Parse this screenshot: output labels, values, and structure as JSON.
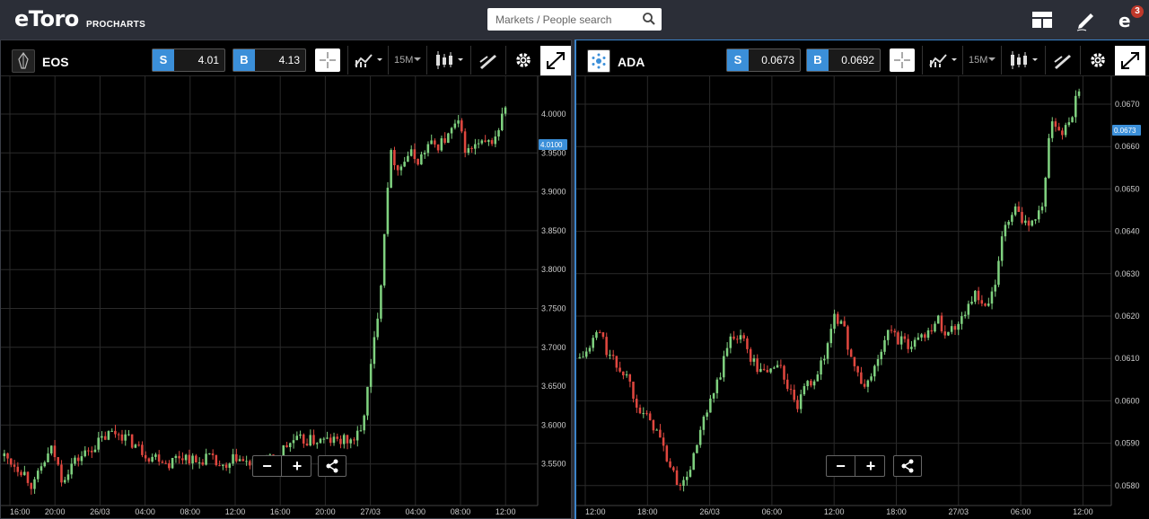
{
  "header": {
    "logo_text": "eToro",
    "logo_sub": "PROCHARTS",
    "search_placeholder": "Markets / People search",
    "notification_count": "3"
  },
  "panels": [
    {
      "asset": "EOS",
      "sell_label": "S",
      "sell_price": "4.01",
      "buy_label": "B",
      "buy_price": "4.13",
      "timeframe": "15M",
      "current_price_tag": "4.0100",
      "y_ticks": [
        "4.0000",
        "3.9500",
        "3.9000",
        "3.8500",
        "3.8000",
        "3.7500",
        "3.7000",
        "3.6500",
        "3.6000",
        "3.5500"
      ],
      "x_ticks": [
        "16:00",
        "20:00",
        "26/03",
        "04:00",
        "08:00",
        "12:00",
        "16:00",
        "20:00",
        "27/03",
        "04:00",
        "08:00",
        "12:00"
      ],
      "zoom_out": "−",
      "zoom_in": "+"
    },
    {
      "asset": "ADA",
      "sell_label": "S",
      "sell_price": "0.0673",
      "buy_label": "B",
      "buy_price": "0.0692",
      "timeframe": "15M",
      "current_price_tag": "0.0673",
      "y_ticks": [
        "0.0670",
        "0.0660",
        "0.0650",
        "0.0640",
        "0.0630",
        "0.0620",
        "0.0610",
        "0.0600",
        "0.0590",
        "0.0580"
      ],
      "x_ticks": [
        "12:00",
        "18:00",
        "26/03",
        "06:00",
        "12:00",
        "18:00",
        "27/03",
        "06:00",
        "12:00"
      ],
      "zoom_out": "−",
      "zoom_in": "+"
    }
  ],
  "colors": {
    "up": "#7fd17f",
    "down": "#e0473f",
    "accent": "#3b8fd9",
    "grid": "#2a2a2a"
  },
  "chart_data": [
    {
      "type": "candlestick",
      "title": "EOS",
      "ylim": [
        3.51,
        4.04
      ],
      "close_path": [
        3.56,
        3.55,
        3.54,
        3.52,
        3.55,
        3.57,
        3.53,
        3.55,
        3.56,
        3.57,
        3.58,
        3.59,
        3.59,
        3.58,
        3.57,
        3.56,
        3.56,
        3.55,
        3.56,
        3.56,
        3.55,
        3.56,
        3.55,
        3.54,
        3.56,
        3.55,
        3.55,
        3.56,
        3.55,
        3.57,
        3.58,
        3.58,
        3.58,
        3.58,
        3.58,
        3.58,
        3.58,
        3.59,
        3.67,
        3.77,
        3.95,
        3.93,
        3.95,
        3.94,
        3.96,
        3.96,
        3.97,
        3.99,
        3.95,
        3.96,
        3.96,
        3.97,
        4.01
      ]
    },
    {
      "type": "candlestick",
      "title": "ADA",
      "ylim": [
        0.0578,
        0.0674
      ],
      "close_path": [
        0.061,
        0.0612,
        0.0617,
        0.0611,
        0.0608,
        0.0606,
        0.06,
        0.0596,
        0.0594,
        0.0588,
        0.0582,
        0.058,
        0.0586,
        0.0594,
        0.06,
        0.0607,
        0.0615,
        0.0616,
        0.0611,
        0.0607,
        0.0607,
        0.0609,
        0.0604,
        0.0598,
        0.0603,
        0.0606,
        0.061,
        0.0621,
        0.0617,
        0.0609,
        0.0603,
        0.0606,
        0.0612,
        0.0617,
        0.0614,
        0.0613,
        0.0615,
        0.0617,
        0.0619,
        0.0616,
        0.0618,
        0.0622,
        0.0625,
        0.0621,
        0.0626,
        0.064,
        0.0645,
        0.0643,
        0.0642,
        0.0645,
        0.0665,
        0.0663,
        0.0666,
        0.0673
      ]
    }
  ]
}
